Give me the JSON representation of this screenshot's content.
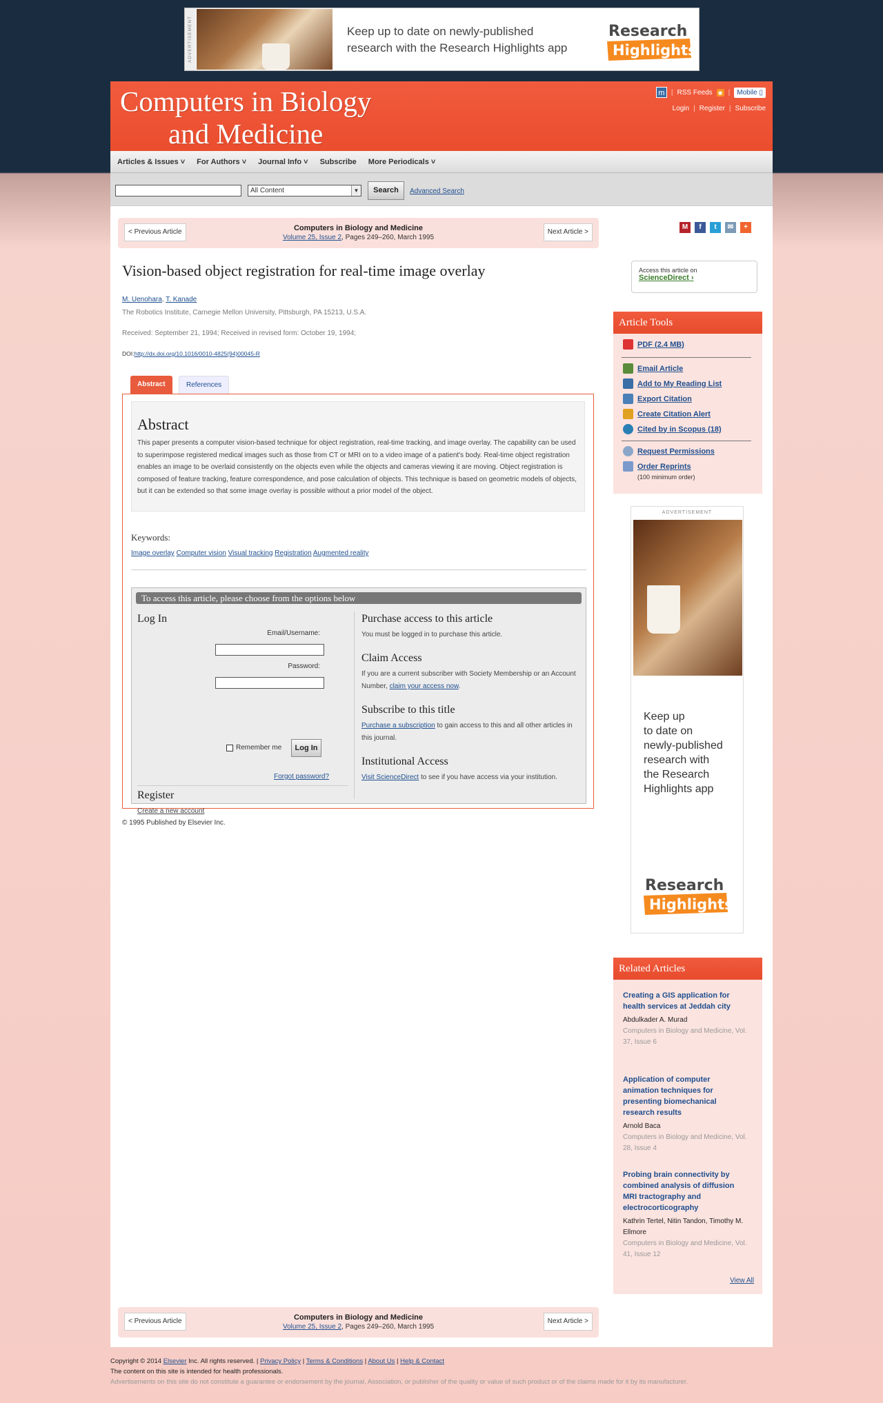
{
  "ad_top": {
    "label": "ADVERTISEMENT",
    "text_line1": "Keep up to date on newly-published",
    "text_line2": "research with the Research Highlights app",
    "logo_word1": "Research",
    "logo_word2": "Highlights"
  },
  "header": {
    "title_line1": "Computers in Biology",
    "title_line2": "and Medicine",
    "rss": "RSS Feeds",
    "mobile": "Mobile",
    "login": "Login",
    "register": "Register",
    "subscribe": "Subscribe"
  },
  "nav": {
    "items": [
      "Articles & Issues",
      "For Authors",
      "Journal Info",
      "Subscribe",
      "More Periodicals"
    ]
  },
  "search": {
    "scope": "All Content",
    "button": "Search",
    "advanced": "Advanced Search"
  },
  "article_nav": {
    "prev": "< Previous Article",
    "next": "Next Article >",
    "journal": "Computers in Biology and Medicine",
    "volume_link": "Volume 25, Issue 2",
    "pages": ", Pages 249–260, March 1995"
  },
  "article": {
    "title": "Vision-based object registration for real-time image overlay",
    "authors": [
      "M. Uenohara",
      "T. Kanade"
    ],
    "affiliation": "The Robotics Institute, Carnegie Mellon University, Pittsburgh, PA 15213, U.S.A.",
    "received": "Received: September 21, 1994; Received in revised form: October 19, 1994;",
    "doi_label": "DOI:",
    "doi": "http://dx.doi.org/10.1016/0010-4825(94)00045-R",
    "tabs": [
      "Abstract",
      "References"
    ],
    "abstract_heading": "Abstract",
    "abstract": "This paper presents a computer vision-based technique for object registration, real-time tracking, and image overlay. The capability can be used to superimpose registered medical images such as those from CT or MRI on to a video image of a patient's body. Real-time object registration enables an image to be overlaid consistently on the objects even while the objects and cameras viewing it are moving. Object registration is composed of feature tracking, feature correspondence, and pose calculation of objects. This technique is based on geometric models of objects, but it can be extended so that some image overlay is possible without a prior model of the object.",
    "keywords_label": "Keywords:",
    "keywords": [
      "Image overlay",
      "Computer vision",
      "Visual tracking",
      "Registration",
      "Augmented reality"
    ],
    "copyright": "© 1995 Published by Elsevier Inc."
  },
  "access": {
    "bar": "To access this article, please choose from the options below",
    "login_heading": "Log In",
    "email_label": "Email/Username:",
    "password_label": "Password:",
    "remember": "Remember me",
    "login_button": "Log In",
    "forgot": "Forgot password?",
    "register_heading": "Register",
    "create_account": "Create a new account",
    "purchase_heading": "Purchase access to this article",
    "purchase_text": "You must be logged in to purchase this article.",
    "claim_heading": "Claim Access",
    "claim_text": "If you are a current subscriber with Society Membership or an Account Number,",
    "claim_link": "claim your access now",
    "subscribe_heading": "Subscribe to this title",
    "subscribe_link": "Purchase a subscription",
    "subscribe_text": " to gain access to this and all other articles in this journal.",
    "inst_heading": "Institutional Access",
    "inst_link": "Visit ScienceDirect",
    "inst_text": " to see if you have access via your institution."
  },
  "sidebar": {
    "sd_text": "Access this article on",
    "sd_link": "ScienceDirect",
    "tools_heading": "Article Tools",
    "tools": [
      "PDF (2.4 MB)",
      "Email Article",
      "Add to My Reading List",
      "Export Citation",
      "Create Citation Alert",
      "Cited by in Scopus (18)",
      "Request Permissions",
      "Order Reprints"
    ],
    "reprint_note": "(100 minimum order)",
    "ad_label": "ADVERTISEMENT",
    "ad_text": [
      "Keep up",
      "to date on",
      "newly-published",
      "research with",
      "the Research",
      "Highlights app"
    ],
    "related_heading": "Related Articles",
    "related": [
      {
        "title": "Creating a GIS application for health services at Jeddah city",
        "authors": "Abdulkader A. Murad",
        "journal": "Computers in Biology and Medicine, Vol. 37, Issue 6"
      },
      {
        "title": "Application of computer animation techniques for presenting biomechanical research results",
        "authors": "Arnold Baca",
        "journal": "Computers in Biology and Medicine, Vol. 28, Issue 4"
      },
      {
        "title": "Probing brain connectivity by combined analysis of diffusion MRI tractography and electrocorticography",
        "authors": "Kathrin Tertel, Nitin Tandon, Timothy M. Ellmore",
        "journal": "Computers in Biology and Medicine, Vol. 41, Issue 12"
      }
    ],
    "view_all": "View All"
  },
  "footer": {
    "copyright": "Copyright © 2014",
    "elsevier": "Elsevier",
    "rights": " Inc. All rights reserved. |",
    "links": [
      "Privacy Policy",
      "Terms & Conditions",
      "About Us",
      "Help & Contact"
    ],
    "line2": "The content on this site is intended for health professionals.",
    "line3": "Advertisements on this site do not constitute a guarantee or endorsement by the journal, Association, or publisher of the quality or value of such product or of the claims made for it by its manufacturer."
  },
  "colors": {
    "brand": "#f15b3d",
    "link": "#1f4f8f",
    "header_bg": "#1a2c3f",
    "page_bg": "#f6ccc5"
  }
}
